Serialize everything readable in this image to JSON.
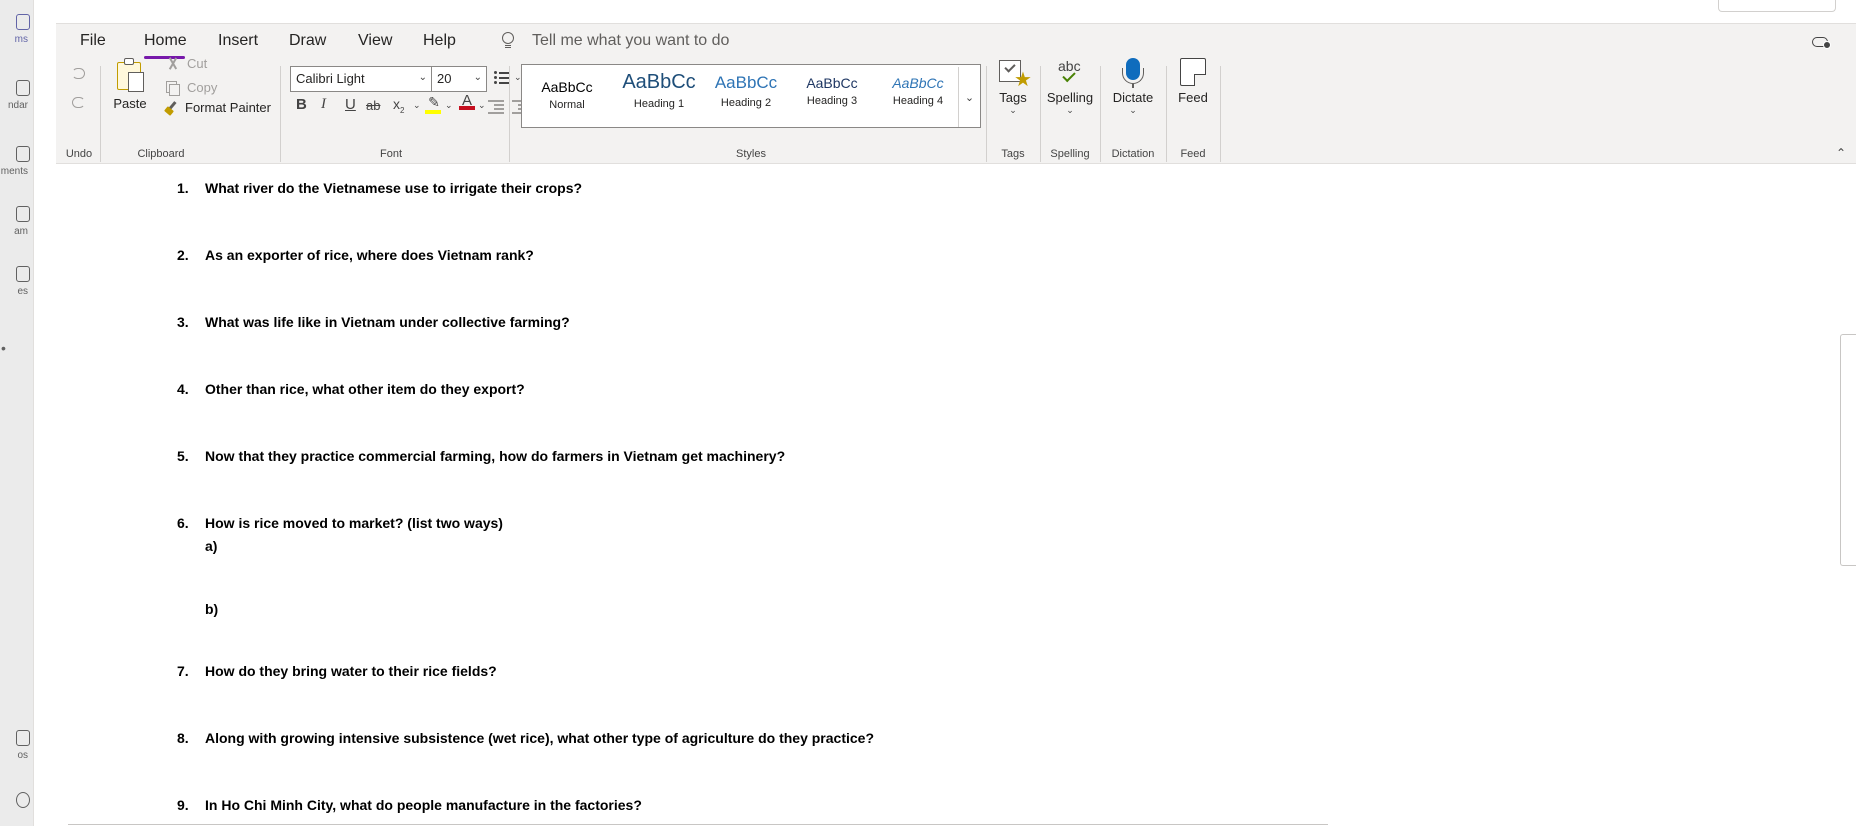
{
  "rail": {
    "items": [
      {
        "label": "ms",
        "active": true
      },
      {
        "label": "ndar"
      },
      {
        "label": "ments"
      },
      {
        "label": "am"
      },
      {
        "label": "es"
      },
      {
        "label": "os"
      }
    ],
    "more": "•"
  },
  "menu": {
    "tabs": [
      "File",
      "Home",
      "Insert",
      "Draw",
      "View",
      "Help"
    ],
    "active_tab": "Home",
    "tell_me": "Tell me what you want to do"
  },
  "ribbon": {
    "undo_group": "Undo",
    "clipboard": {
      "paste": "Paste",
      "cut": "Cut",
      "copy": "Copy",
      "format_painter": "Format Painter",
      "label": "Clipboard"
    },
    "font": {
      "family": "Calibri Light",
      "size": "20",
      "label": "Font",
      "bold": "B",
      "italic": "I",
      "underline": "U",
      "strike": "ab",
      "subscript": "x",
      "subscript_sub": "2",
      "font_color": "A",
      "clear": "A",
      "highlight_color": "#ffff00",
      "font_color_value": "#c50f1f"
    },
    "styles": {
      "label": "Styles",
      "items": [
        {
          "sample": "AaBbCc",
          "name": "Normal"
        },
        {
          "sample": "AaBbCc",
          "name": "Heading 1"
        },
        {
          "sample": "AaBbCc",
          "name": "Heading 2"
        },
        {
          "sample": "AaBbCc",
          "name": "Heading 3"
        },
        {
          "sample": "AaBbCc",
          "name": "Heading 4"
        }
      ]
    },
    "tags": {
      "button": "Tags",
      "label": "Tags"
    },
    "spelling": {
      "button": "Spelling",
      "label": "Spelling",
      "glyph": "abc"
    },
    "dictation": {
      "button": "Dictate",
      "label": "Dictation"
    },
    "feed": {
      "button": "Feed",
      "label": "Feed"
    }
  },
  "content": {
    "questions": [
      {
        "num": "1.",
        "text": "What river do the Vietnamese use to irrigate their crops?"
      },
      {
        "num": "2.",
        "text": "As an exporter of rice, where does Vietnam rank?"
      },
      {
        "num": "3.",
        "text": "What was life like in Vietnam under collective farming?"
      },
      {
        "num": "4.",
        "text": "Other than rice, what other item do they export?"
      },
      {
        "num": "5.",
        "text": "Now that they practice commercial farming, how do farmers in Vietnam get machinery?"
      },
      {
        "num": "6.",
        "text": "How is rice moved to market? (list two ways)"
      },
      {
        "num": "7.",
        "text": "How do they bring water to their rice fields?"
      },
      {
        "num": "8.",
        "text": "Along with growing intensive subsistence (wet rice), what other type of agriculture do they practice?"
      },
      {
        "num": "9.",
        "text": "In Ho Chi Minh City, what do people manufacture in the factories?"
      }
    ],
    "sub_a": "a)",
    "sub_b": "b)"
  }
}
